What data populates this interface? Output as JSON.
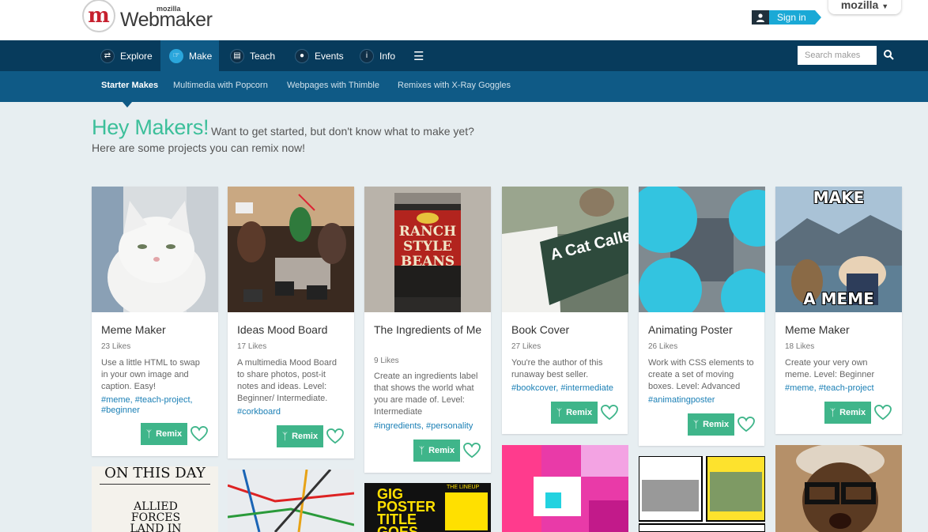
{
  "header": {
    "logo_small": "mozilla",
    "logo_name": "Webmaker",
    "signin_label": "Sign in",
    "mozilla_tab": "mozilla"
  },
  "nav": {
    "items": [
      {
        "label": "Explore",
        "icon": "shuffle-icon"
      },
      {
        "label": "Make",
        "icon": "hand-icon"
      },
      {
        "label": "Teach",
        "icon": "book-icon"
      },
      {
        "label": "Events",
        "icon": "map-pin-icon"
      },
      {
        "label": "Info",
        "icon": "info-icon"
      }
    ],
    "menu_icon": "hamburger-icon",
    "search_placeholder": "Search makes"
  },
  "subnav": {
    "items": [
      "Starter Makes",
      "Multimedia with Popcorn",
      "Webpages with Thimble",
      "Remixes with X-Ray Goggles"
    ]
  },
  "intro": {
    "heading": "Hey Makers!",
    "line1": "Want to get started, but don't know what to make yet?",
    "line2": "Here are some projects you can remix now!"
  },
  "remix_label": "Remix",
  "cards": [
    {
      "title": "Meme Maker",
      "likes": "23 Likes",
      "desc": "Use a little HTML to swap in your own image and caption. Easy!",
      "tags": "#meme, #teach-project, #beginner"
    },
    {
      "title": "Ideas Mood Board",
      "likes": "17 Likes",
      "desc": "A multimedia Mood Board to share photos, post-it notes and ideas. Level: Beginner/ Intermediate.",
      "tags": "#corkboard"
    },
    {
      "title": "The Ingredients of Me",
      "likes": "9 Likes",
      "desc": "Create an ingredients label that shows the world what you are made of. Level: Intermediate",
      "tags": "#ingredients, #personality",
      "image_text": "RANCH STYLE BEANS"
    },
    {
      "title": "Book Cover",
      "likes": "27 Likes",
      "desc": "You're the author of this runaway best seller.",
      "tags": "#bookcover, #intermediate",
      "image_text": "A Cat Called"
    },
    {
      "title": "Animating Poster",
      "likes": "26 Likes",
      "desc": "Work with CSS elements to create a set of moving boxes. Level: Advanced",
      "tags": "#animatingposter"
    },
    {
      "title": "Meme Maker",
      "likes": "18 Likes",
      "desc": "Create your very own meme. Level: Beginner",
      "tags": "#meme, #teach-project",
      "image_top": "MAKE",
      "image_bottom": "A MEME"
    }
  ],
  "bottom": {
    "on_this_day": "ON THIS DAY",
    "allied": "ALLIED FORCES LAND IN FRANCE",
    "gig": "GIG POSTER TITLE GOES",
    "lineup": "THE LINEUP"
  },
  "colors": {
    "nav": "#073b5c",
    "subnav": "#0f5a86",
    "accent": "#3cbf9a",
    "remix": "#3fb58a",
    "link": "#1a7fb5"
  }
}
